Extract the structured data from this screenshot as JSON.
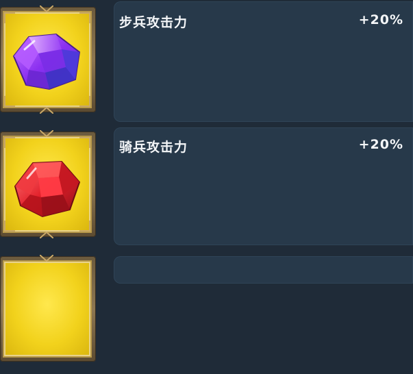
{
  "attributes": [
    {
      "name": "步兵攻击力",
      "value": "+20%",
      "gem": "purple-gem-icon",
      "gem_color": "#8a3cf0"
    },
    {
      "name": "骑兵攻击力",
      "value": "+20%",
      "gem": "red-gem-icon",
      "gem_color": "#e3212b"
    }
  ],
  "colors": {
    "background": "#1f2b38",
    "panel": "#27394a",
    "tile_gold": "#f2d21c",
    "text": "#f4f6f8"
  }
}
